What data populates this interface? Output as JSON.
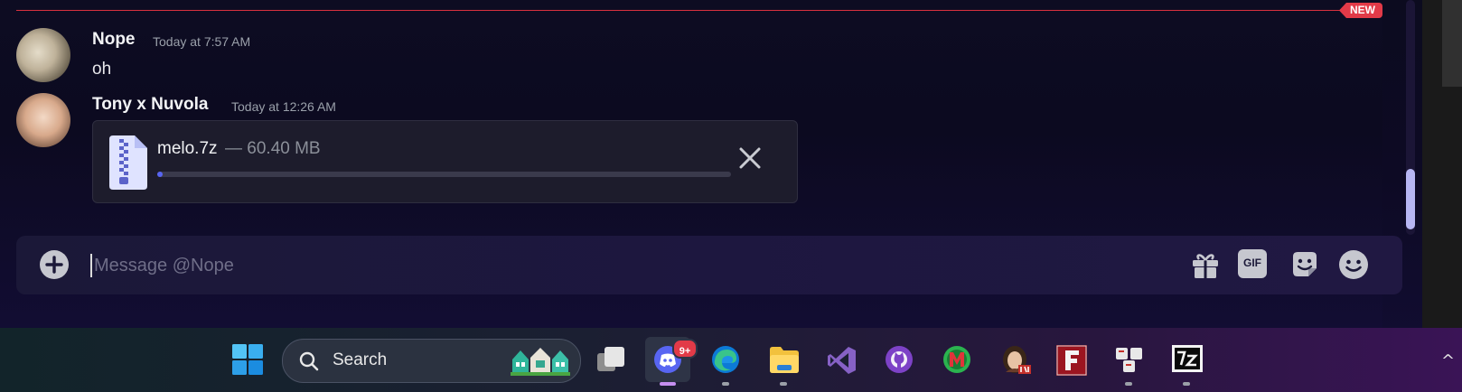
{
  "chat": {
    "new_badge": "NEW",
    "messages": [
      {
        "author": "Nope",
        "timestamp": "Today at 7:57 AM",
        "text": "oh"
      },
      {
        "author": "Tony x Nuvola",
        "timestamp": "Today at 12:26 AM",
        "attachment": {
          "filename": "melo.7z",
          "size": "— 60.40 MB",
          "progress": 0.01
        }
      }
    ]
  },
  "composer": {
    "placeholder": "Message @Nope",
    "buttons": [
      "add-icon",
      "gift-icon",
      "gif-icon",
      "sticker-icon",
      "emoji-icon"
    ],
    "gif_label": "GIF"
  },
  "taskbar": {
    "search_label": "Search",
    "discord_badge": "9+",
    "apps": [
      "windows-start",
      "search",
      "task-view",
      "discord",
      "edge",
      "file-explorer",
      "visual-studio",
      "github-desktop",
      "m-app",
      "portrait-app",
      "f-app",
      "keyboard-app",
      "7zip"
    ],
    "show_hidden_icons": "^"
  },
  "colors": {
    "accent": "#5865f2",
    "new_line": "#d8303f",
    "badge": "#e23a48"
  }
}
